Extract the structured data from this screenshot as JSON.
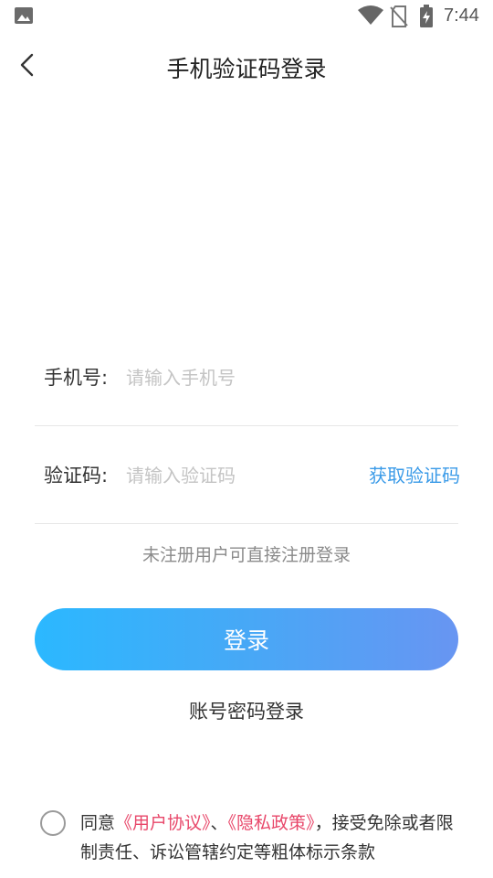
{
  "status_bar": {
    "time": "7:44"
  },
  "nav": {
    "title": "手机验证码登录"
  },
  "form": {
    "phone_label": "手机号:",
    "phone_placeholder": "请输入手机号",
    "code_label": "验证码:",
    "code_placeholder": "请输入验证码",
    "get_code": "获取验证码"
  },
  "hint": "未注册用户可直接注册登录",
  "login_button": "登录",
  "alt_login": "账号密码登录",
  "agreement": {
    "prefix": "同意",
    "user_agreement": "《用户协议》",
    "separator": "、",
    "privacy_policy": "《隐私政策》",
    "suffix": "，接受免除或者限制责任、诉讼管辖约定等粗体标示条款"
  },
  "colors": {
    "accent": "#3b9be8",
    "link": "#e8476a",
    "gradient_start": "#2bb8ff",
    "gradient_end": "#6895f2"
  }
}
